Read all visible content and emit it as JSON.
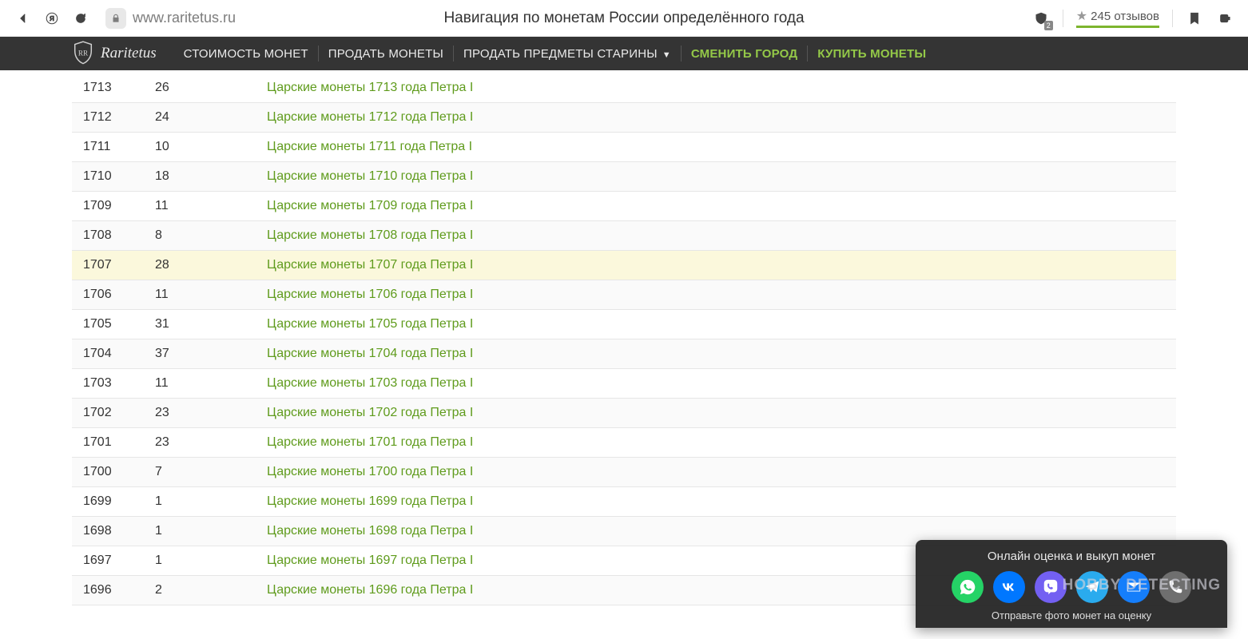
{
  "browser": {
    "url": "www.raritetus.ru",
    "page_title": "Навигация по монетам России определённого года",
    "shield_count": "2",
    "reviews": "245 отзывов"
  },
  "nav": {
    "logo": "Raritetus",
    "items": [
      {
        "label": "СТОИМОСТЬ МОНЕТ",
        "green": false,
        "dropdown": false
      },
      {
        "label": "ПРОДАТЬ МОНЕТЫ",
        "green": false,
        "dropdown": false
      },
      {
        "label": "ПРОДАТЬ ПРЕДМЕТЫ СТАРИНЫ",
        "green": false,
        "dropdown": true
      },
      {
        "label": "СМЕНИТЬ ГОРОД",
        "green": true,
        "dropdown": false
      },
      {
        "label": "КУПИТЬ МОНЕТЫ",
        "green": true,
        "dropdown": false
      }
    ]
  },
  "rows": [
    {
      "year": "1713",
      "count": "26",
      "link": "Царские монеты 1713 года Петра I",
      "hl": false
    },
    {
      "year": "1712",
      "count": "24",
      "link": "Царские монеты 1712 года Петра I",
      "hl": false
    },
    {
      "year": "1711",
      "count": "10",
      "link": "Царские монеты 1711 года Петра I",
      "hl": false
    },
    {
      "year": "1710",
      "count": "18",
      "link": "Царские монеты 1710 года Петра I",
      "hl": false
    },
    {
      "year": "1709",
      "count": "11",
      "link": "Царские монеты 1709 года Петра I",
      "hl": false
    },
    {
      "year": "1708",
      "count": "8",
      "link": "Царские монеты 1708 года Петра I",
      "hl": false
    },
    {
      "year": "1707",
      "count": "28",
      "link": "Царские монеты 1707 года Петра I",
      "hl": true
    },
    {
      "year": "1706",
      "count": "11",
      "link": "Царские монеты 1706 года Петра I",
      "hl": false
    },
    {
      "year": "1705",
      "count": "31",
      "link": "Царские монеты 1705 года Петра I",
      "hl": false
    },
    {
      "year": "1704",
      "count": "37",
      "link": "Царские монеты 1704 года Петра I",
      "hl": false
    },
    {
      "year": "1703",
      "count": "11",
      "link": "Царские монеты 1703 года Петра I",
      "hl": false
    },
    {
      "year": "1702",
      "count": "23",
      "link": "Царские монеты 1702 года Петра I",
      "hl": false
    },
    {
      "year": "1701",
      "count": "23",
      "link": "Царские монеты 1701 года Петра I",
      "hl": false
    },
    {
      "year": "1700",
      "count": "7",
      "link": "Царские монеты 1700 года Петра I",
      "hl": false
    },
    {
      "year": "1699",
      "count": "1",
      "link": "Царские монеты 1699 года Петра I",
      "hl": false
    },
    {
      "year": "1698",
      "count": "1",
      "link": "Царские монеты 1698 года Петра I",
      "hl": false
    },
    {
      "year": "1697",
      "count": "1",
      "link": "Царские монеты 1697 года Петра I",
      "hl": false
    },
    {
      "year": "1696",
      "count": "2",
      "link": "Царские монеты 1696 года Петра I",
      "hl": false
    }
  ],
  "float": {
    "title": "Онлайн оценка и выкуп монет",
    "subtitle": "Отправьте фото монет на оценку"
  },
  "watermark": "HOBBY    DETECTING"
}
